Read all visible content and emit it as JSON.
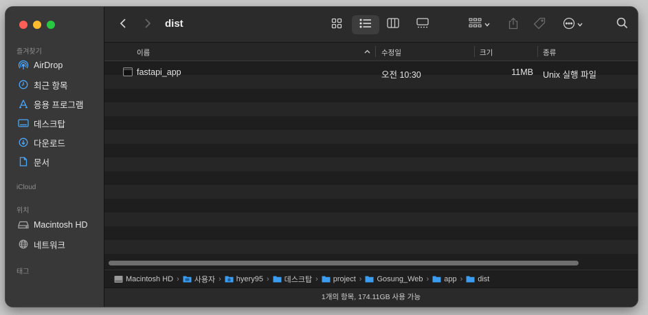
{
  "window": {
    "traffic_lights": {
      "close": "#ff5f57",
      "minimize": "#febc2e",
      "zoom": "#28c840"
    }
  },
  "sidebar": {
    "favorites_header": "즐겨찾기",
    "favorites": [
      {
        "label": "AirDrop",
        "icon": "airdrop-icon"
      },
      {
        "label": "최근 항목",
        "icon": "clock-icon"
      },
      {
        "label": "응용 프로그램",
        "icon": "applications-icon"
      },
      {
        "label": "데스크탑",
        "icon": "desktop-icon"
      },
      {
        "label": "다운로드",
        "icon": "download-icon"
      },
      {
        "label": "문서",
        "icon": "document-icon"
      }
    ],
    "icloud_header": "iCloud",
    "locations_header": "위치",
    "locations": [
      {
        "label": "Macintosh HD",
        "icon": "hard-drive-icon"
      },
      {
        "label": "네트워크",
        "icon": "network-icon"
      }
    ],
    "tags_header": "태그",
    "accent_color": "#4aa8ff"
  },
  "toolbar": {
    "title": "dist",
    "view_selected": "list"
  },
  "columns": {
    "name": "이름",
    "modified": "수정일",
    "size": "크기",
    "kind": "종류"
  },
  "files": [
    {
      "name": "fastapi_app",
      "modified": "오전 10:30",
      "size": "11MB",
      "kind": "Unix 실행 파일"
    }
  ],
  "pathbar": {
    "crumbs": [
      "Macintosh HD",
      "사용자",
      "hyery95",
      "데스크탑",
      "project",
      "Gosung_Web",
      "app",
      "dist"
    ],
    "separator": "›"
  },
  "status": {
    "text": "1개의 항목, 174.11GB 사용 가능"
  }
}
